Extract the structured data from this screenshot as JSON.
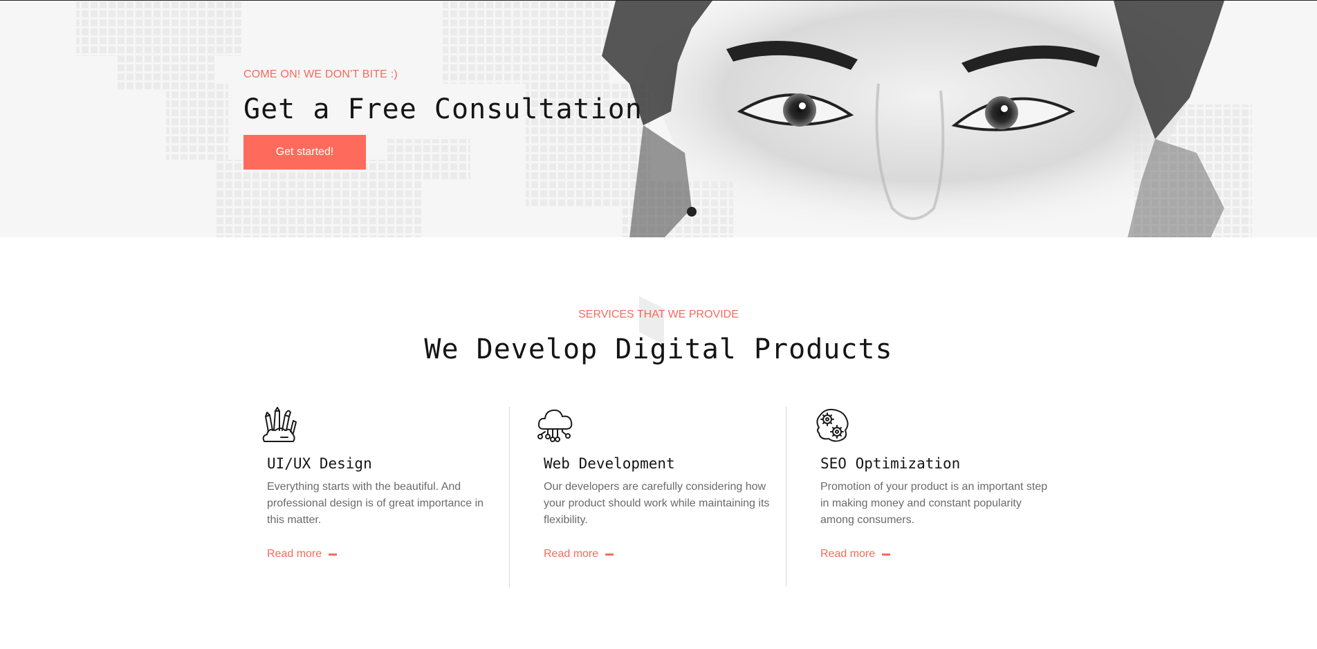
{
  "hero": {
    "eyebrow": "COME ON! WE DON'T BITE :)",
    "title": "Get a Free Consultation",
    "button_label": "Get started!"
  },
  "services": {
    "eyebrow": "SERVICES THAT WE PROVIDE",
    "title": "We Develop Digital Products",
    "items": [
      {
        "icon": "design-tools-icon",
        "title": "UI/UX Design",
        "description": "Everything starts with the beautiful. And professional design is of great importance in this matter.",
        "link": "Read more"
      },
      {
        "icon": "cloud-network-icon",
        "title": "Web Development",
        "description": "Our developers are carefully considering how your product should work while maintaining its flexibility.",
        "link": "Read more"
      },
      {
        "icon": "gears-cloud-icon",
        "title": "SEO Optimization",
        "description": "Promotion of your product is an important step in making money and constant popularity among consumers.",
        "link": "Read more"
      }
    ]
  },
  "colors": {
    "accent": "#fe6b5c",
    "heading": "#151515",
    "body_text": "#6a6a6a",
    "hero_bg": "#f6f6f6"
  }
}
